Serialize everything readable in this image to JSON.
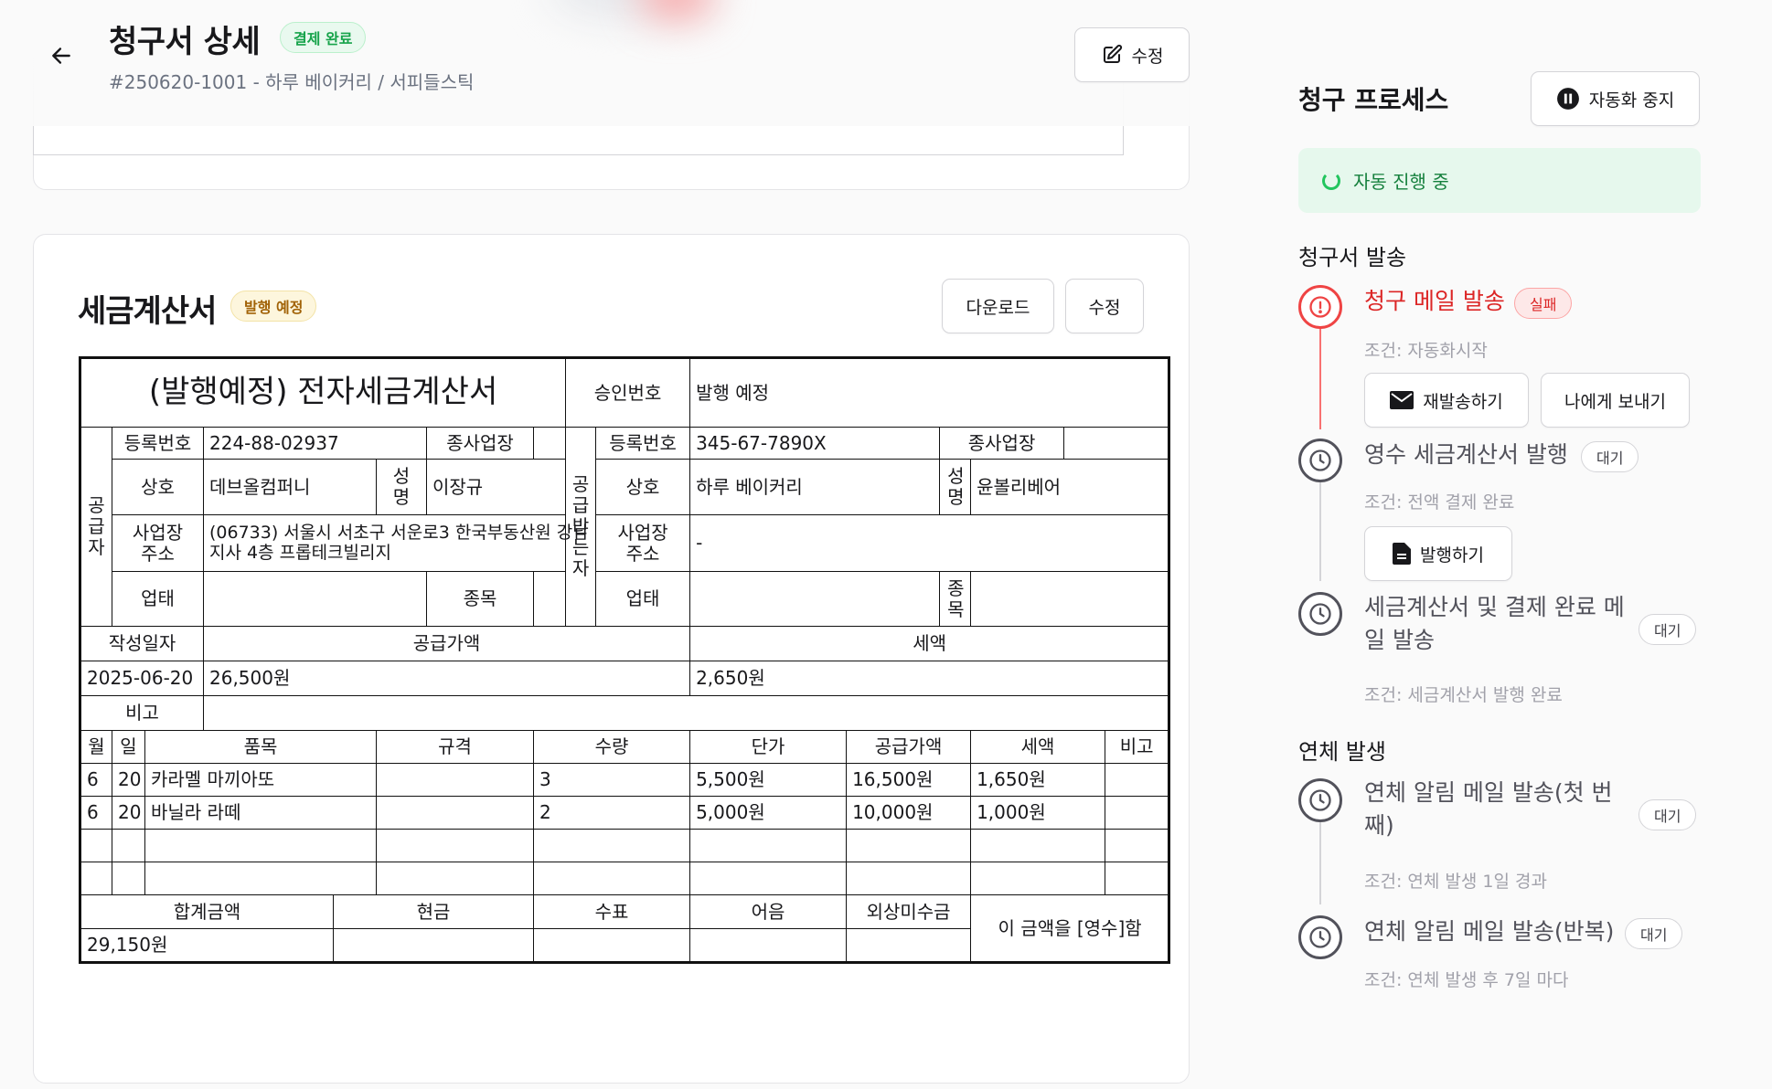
{
  "header": {
    "title": "청구서 상세",
    "status_badge": "결제 완료",
    "subtitle": "#250620-1001 - 하루 베이커리 / 서피들스틱",
    "edit_label": "수정"
  },
  "tax_invoice": {
    "title": "세금계산서",
    "status_badge": "발행 예정",
    "download_label": "다운로드",
    "edit_label": "수정",
    "doc_title": "(발행예정) 전자세금계산서",
    "approval_label": "승인번호",
    "approval_value": "발행 예정",
    "supplier_label": "공급자",
    "recipient_label": "공급받는자",
    "labels": {
      "reg_no": "등록번호",
      "branch": "종사업장",
      "company": "상호",
      "name": "성명",
      "address": "사업장 주소",
      "business_type": "업태",
      "item_type": "종목",
      "date": "작성일자",
      "supply_amount": "공급가액",
      "tax": "세액",
      "note": "비고",
      "month": "월",
      "day": "일",
      "item": "품목",
      "spec": "규격",
      "qty": "수량",
      "unit_price": "단가",
      "total": "합계금액",
      "cash": "현금",
      "check": "수표",
      "bill": "어음",
      "credit": "외상미수금",
      "receipt_text": "이 금액을 [영수]함"
    },
    "supplier": {
      "reg_no": "224-88-02937",
      "company": "데브올컴퍼니",
      "name": "이장규",
      "address": "(06733) 서울시 서초구 서운로3 한국부동산원 강남지사 4층 프롭테크빌리지"
    },
    "recipient": {
      "reg_no": "345-67-7890X",
      "company": "하루 베이커리",
      "name": "윤볼리베어",
      "address": "-"
    },
    "date": "2025-06-20",
    "supply_amount": "26,500원",
    "tax": "2,650원",
    "items": [
      {
        "month": "6",
        "day": "20",
        "item": "카라멜 마끼아또",
        "spec": "",
        "qty": "3",
        "unit_price": "5,500원",
        "supply": "16,500원",
        "tax": "1,650원",
        "note": ""
      },
      {
        "month": "6",
        "day": "20",
        "item": "바닐라 라떼",
        "spec": "",
        "qty": "2",
        "unit_price": "5,000원",
        "supply": "10,000원",
        "tax": "1,000원",
        "note": ""
      }
    ],
    "total": "29,150원"
  },
  "sidebar": {
    "title": "청구 프로세스",
    "pause_label": "자동화 중지",
    "auto_status": "자동 진행 중",
    "section_invoice": "청구서 발송",
    "section_overdue": "연체 발생",
    "steps": [
      {
        "title": "청구 메일 발송",
        "badge": "실패",
        "condition": "조건: 자동화시작",
        "resend_label": "재발송하기",
        "send_self_label": "나에게 보내기"
      },
      {
        "title": "영수 세금계산서 발행",
        "badge": "대기",
        "condition": "조건: 전액 결제 완료",
        "issue_label": "발행하기"
      },
      {
        "title": "세금계산서 및 결제 완료 메일 발송",
        "badge": "대기",
        "condition": "조건: 세금계산서 발행 완료"
      },
      {
        "title": "연체 알림 메일 발송(첫 번째)",
        "badge": "대기",
        "condition": "조건: 연체 발생 1일 경과"
      },
      {
        "title": "연체 알림 메일 발송(반복)",
        "badge": "대기",
        "condition": "조건: 연체 발생 후 7일 마다"
      }
    ]
  }
}
